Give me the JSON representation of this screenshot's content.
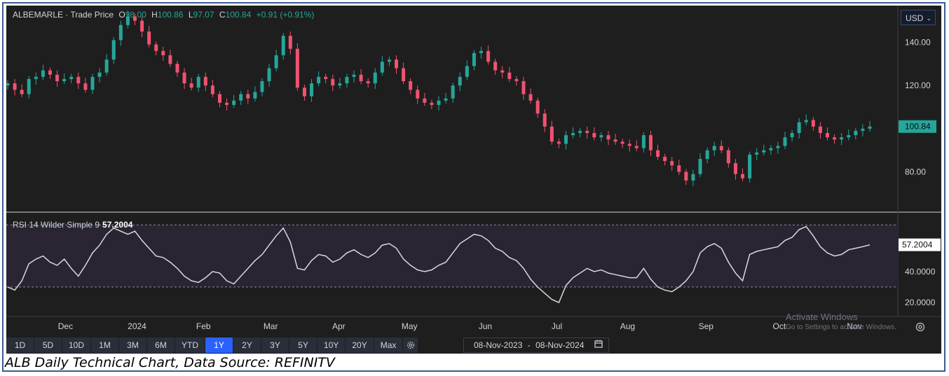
{
  "header": {
    "symbol": "ALBEMARLE · Trade Price",
    "open_label": "O",
    "open_value": "98.00",
    "high_label": "H",
    "high_value": "100.86",
    "low_label": "L",
    "low_value": "97.07",
    "close_label": "C",
    "close_value": "100.84",
    "change": "+0.91 (+0.91%)"
  },
  "currency": {
    "label": "USD"
  },
  "rsi": {
    "label": "RSI 14 Wilder Simple 9",
    "value": "57.2004"
  },
  "toolbar": {
    "ranges": [
      "1D",
      "5D",
      "10D",
      "1M",
      "3M",
      "6M",
      "YTD",
      "1Y",
      "2Y",
      "3Y",
      "5Y",
      "10Y",
      "20Y",
      "Max"
    ],
    "active": "1Y",
    "date_from": "08-Nov-2023",
    "date_sep": "-",
    "date_to": "08-Nov-2024"
  },
  "watermark": {
    "line1": "Activate Windows",
    "line2": "Go to Settings to activate Windows."
  },
  "caption": "ALB Daily Technical Chart, Data Source: REFINITV",
  "colors": {
    "up": "#26a69a",
    "down": "#ef5370",
    "background": "#1e1e1e",
    "rsi_line": "#d9d9d9",
    "rsi_band": "#2a2433",
    "active": "#2962ff"
  },
  "chart_data": [
    {
      "type": "candlestick",
      "title": "ALBEMARLE · Trade Price",
      "x_tick_labels": [
        "Dec",
        "2024",
        "Feb",
        "Mar",
        "Apr",
        "May",
        "Jun",
        "Jul",
        "Aug",
        "Sep",
        "Oct",
        "Nov"
      ],
      "y_tick_labels": [
        "80.00",
        "100.00",
        "120.00",
        "140.00"
      ],
      "ylim": [
        62,
        157
      ],
      "last_price_label": "100.84",
      "close_series": [
        121,
        118,
        116,
        123,
        124,
        127,
        125,
        122,
        123,
        124,
        121,
        118,
        124,
        126,
        132,
        141,
        148,
        152,
        150,
        145,
        139,
        136,
        134,
        130,
        126,
        121,
        119,
        124,
        120,
        116,
        112,
        111,
        113,
        116,
        114,
        117,
        122,
        128,
        134,
        143,
        137,
        119,
        115,
        121,
        124,
        123,
        120,
        121,
        124,
        125,
        122,
        121,
        126,
        131,
        132,
        128,
        122,
        118,
        114,
        112,
        111,
        113,
        114,
        120,
        124,
        129,
        135,
        136,
        131,
        127,
        126,
        123,
        122,
        116,
        113,
        107,
        101,
        94,
        93,
        97,
        98,
        99,
        98,
        96,
        97,
        95,
        94,
        93,
        92,
        91,
        97,
        90,
        87,
        85,
        83,
        80,
        76,
        79,
        86,
        90,
        92,
        90,
        84,
        79,
        77,
        88,
        89,
        90,
        91,
        92,
        96,
        98,
        103,
        104,
        101,
        98,
        96,
        95,
        96,
        97,
        99,
        100,
        101
      ]
    },
    {
      "type": "line",
      "title": "RSI 14 Wilder Simple 9",
      "y_tick_labels": [
        "20.0000",
        "40.0000"
      ],
      "ylim": [
        11,
        76
      ],
      "band": [
        30,
        70
      ],
      "last_value_label": "57.2004",
      "values": [
        30,
        28,
        34,
        45,
        48,
        50,
        46,
        44,
        48,
        42,
        37,
        44,
        52,
        57,
        64,
        68,
        66,
        64,
        66,
        60,
        55,
        50,
        49,
        46,
        42,
        37,
        34,
        33,
        36,
        40,
        39,
        34,
        32,
        37,
        42,
        47,
        51,
        57,
        63,
        68,
        59,
        42,
        41,
        47,
        51,
        50,
        46,
        48,
        52,
        54,
        51,
        49,
        52,
        57,
        58,
        55,
        48,
        44,
        41,
        40,
        41,
        44,
        46,
        52,
        58,
        61,
        64,
        63,
        60,
        55,
        53,
        49,
        47,
        42,
        35,
        30,
        26,
        22,
        20,
        31,
        36,
        39,
        42,
        40,
        41,
        39,
        38,
        37,
        36,
        36,
        42,
        35,
        30,
        28,
        27,
        30,
        34,
        40,
        52,
        56,
        58,
        55,
        46,
        39,
        34,
        51,
        53,
        54,
        55,
        56,
        60,
        62,
        67,
        69,
        63,
        56,
        52,
        50,
        51,
        54,
        55,
        56,
        57.2
      ]
    }
  ]
}
